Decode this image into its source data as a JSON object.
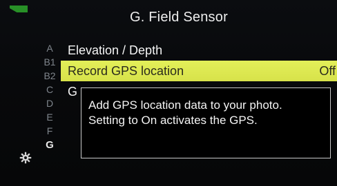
{
  "header": {
    "title": "G. Field Sensor"
  },
  "status": {
    "icon": "battery-icon",
    "color": "#2ea82c"
  },
  "tabs": [
    {
      "label": "A"
    },
    {
      "label": "B1"
    },
    {
      "label": "B2"
    },
    {
      "label": "C"
    },
    {
      "label": "D"
    },
    {
      "label": "E"
    },
    {
      "label": "F"
    },
    {
      "label": "G"
    }
  ],
  "active_tab": "G",
  "menu": {
    "items": [
      {
        "label": "Elevation / Depth",
        "value": ""
      },
      {
        "label": "Record GPS location",
        "value": "Off"
      },
      {
        "label": "G",
        "value": ""
      }
    ]
  },
  "help": {
    "text": "Add GPS location data to your photo. Setting to On activates the GPS."
  },
  "colors": {
    "highlight": "#dde64f",
    "background": "#07080a",
    "text": "#f2f2f2"
  },
  "icons": {
    "settings": "gear-icon"
  }
}
